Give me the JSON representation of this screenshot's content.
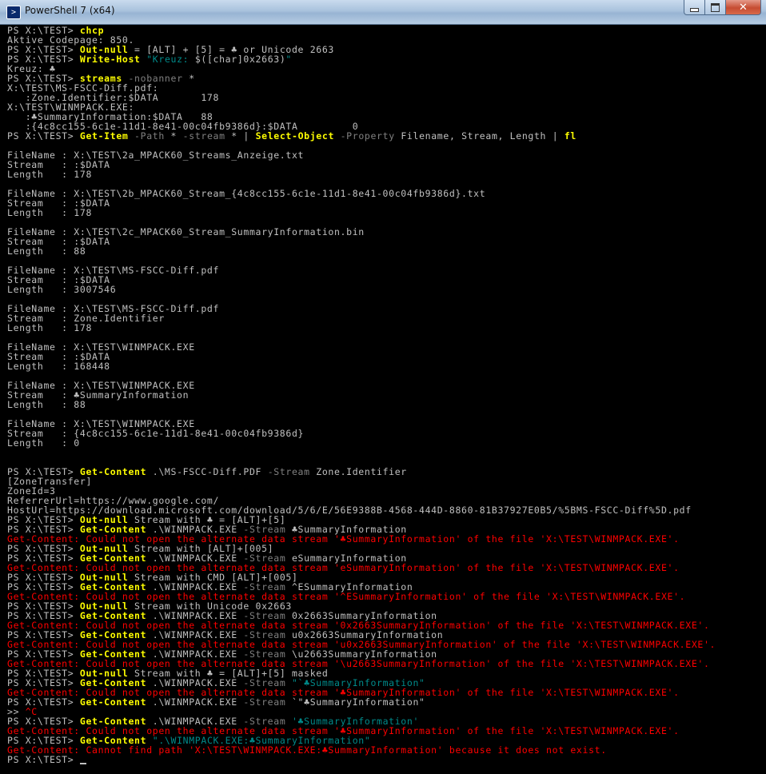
{
  "window": {
    "title": "PowerShell 7 (x64)",
    "close_glyph": "✕",
    "icon_glyph": ">"
  },
  "colors": {
    "background": "#000000",
    "default": "#c0c0c0",
    "command": "#ffff00",
    "parameter": "#808080",
    "string": "#008b8b",
    "error": "#ff0000"
  },
  "console": {
    "lines": [
      [
        [
          "PS X:\\TEST> ",
          "default"
        ],
        [
          "chcp",
          "command"
        ]
      ],
      [
        [
          "Aktive Codepage: 850.",
          "default"
        ]
      ],
      [
        [
          "PS X:\\TEST> ",
          "default"
        ],
        [
          "Out-null",
          "command"
        ],
        [
          " = [ALT] + [5] = ♣ or Unicode 2663",
          "default"
        ]
      ],
      [
        [
          "PS X:\\TEST> ",
          "default"
        ],
        [
          "Write-Host",
          "command"
        ],
        [
          " ",
          "default"
        ],
        [
          "\"Kreuz: ",
          "string"
        ],
        [
          "$([char]0x2663)",
          "default"
        ],
        [
          "\"",
          "string"
        ]
      ],
      [
        [
          "Kreuz: ♣",
          "default"
        ]
      ],
      [
        [
          "PS X:\\TEST> ",
          "default"
        ],
        [
          "streams",
          "command"
        ],
        [
          " -nobanner",
          "parameter"
        ],
        [
          " *",
          "default"
        ]
      ],
      [
        [
          "X:\\TEST\\MS-FSCC-Diff.pdf:",
          "default"
        ]
      ],
      [
        [
          "   :Zone.Identifier:$DATA       178",
          "default"
        ]
      ],
      [
        [
          "X:\\TEST\\WINMPACK.EXE:",
          "default"
        ]
      ],
      [
        [
          "   :♣SummaryInformation:$DATA   88",
          "default"
        ]
      ],
      [
        [
          "   :{4c8cc155-6c1e-11d1-8e41-00c04fb9386d}:$DATA         0",
          "default"
        ]
      ],
      [
        [
          "PS X:\\TEST> ",
          "default"
        ],
        [
          "Get-Item",
          "command"
        ],
        [
          " -Path",
          "parameter"
        ],
        [
          " * ",
          "default"
        ],
        [
          "-stream",
          "parameter"
        ],
        [
          " * | ",
          "default"
        ],
        [
          "Select-Object",
          "command"
        ],
        [
          " -Property",
          "parameter"
        ],
        [
          " Filename, Stream, Length | ",
          "default"
        ],
        [
          "fl",
          "command"
        ]
      ],
      [],
      [
        [
          "FileName : X:\\TEST\\2a_MPACK60_Streams_Anzeige.txt",
          "default"
        ]
      ],
      [
        [
          "Stream   : :$DATA",
          "default"
        ]
      ],
      [
        [
          "Length   : 178",
          "default"
        ]
      ],
      [],
      [
        [
          "FileName : X:\\TEST\\2b_MPACK60_Stream_{4c8cc155-6c1e-11d1-8e41-00c04fb9386d}.txt",
          "default"
        ]
      ],
      [
        [
          "Stream   : :$DATA",
          "default"
        ]
      ],
      [
        [
          "Length   : 178",
          "default"
        ]
      ],
      [],
      [
        [
          "FileName : X:\\TEST\\2c_MPACK60_Stream_SummaryInformation.bin",
          "default"
        ]
      ],
      [
        [
          "Stream   : :$DATA",
          "default"
        ]
      ],
      [
        [
          "Length   : 88",
          "default"
        ]
      ],
      [],
      [
        [
          "FileName : X:\\TEST\\MS-FSCC-Diff.pdf",
          "default"
        ]
      ],
      [
        [
          "Stream   : :$DATA",
          "default"
        ]
      ],
      [
        [
          "Length   : 3007546",
          "default"
        ]
      ],
      [],
      [
        [
          "FileName : X:\\TEST\\MS-FSCC-Diff.pdf",
          "default"
        ]
      ],
      [
        [
          "Stream   : Zone.Identifier",
          "default"
        ]
      ],
      [
        [
          "Length   : 178",
          "default"
        ]
      ],
      [],
      [
        [
          "FileName : X:\\TEST\\WINMPACK.EXE",
          "default"
        ]
      ],
      [
        [
          "Stream   : :$DATA",
          "default"
        ]
      ],
      [
        [
          "Length   : 168448",
          "default"
        ]
      ],
      [],
      [
        [
          "FileName : X:\\TEST\\WINMPACK.EXE",
          "default"
        ]
      ],
      [
        [
          "Stream   : ♣SummaryInformation",
          "default"
        ]
      ],
      [
        [
          "Length   : 88",
          "default"
        ]
      ],
      [],
      [
        [
          "FileName : X:\\TEST\\WINMPACK.EXE",
          "default"
        ]
      ],
      [
        [
          "Stream   : {4c8cc155-6c1e-11d1-8e41-00c04fb9386d}",
          "default"
        ]
      ],
      [
        [
          "Length   : 0",
          "default"
        ]
      ],
      [],
      [],
      [
        [
          "PS X:\\TEST> ",
          "default"
        ],
        [
          "Get-Content",
          "command"
        ],
        [
          " .\\MS-FSCC-Diff.PDF ",
          "default"
        ],
        [
          "-Stream",
          "parameter"
        ],
        [
          " Zone.Identifier",
          "default"
        ]
      ],
      [
        [
          "[ZoneTransfer]",
          "default"
        ]
      ],
      [
        [
          "ZoneId=3",
          "default"
        ]
      ],
      [
        [
          "ReferrerUrl=https://www.google.com/",
          "default"
        ]
      ],
      [
        [
          "HostUrl=https://download.microsoft.com/download/5/6/E/56E9388B-4568-444D-8860-81B37927E0B5/%5BMS-FSCC-Diff%5D.pdf",
          "default"
        ]
      ],
      [
        [
          "PS X:\\TEST> ",
          "default"
        ],
        [
          "Out-null",
          "command"
        ],
        [
          " Stream with ♣ = [ALT]+[5]",
          "default"
        ]
      ],
      [
        [
          "PS X:\\TEST> ",
          "default"
        ],
        [
          "Get-Content",
          "command"
        ],
        [
          " .\\WINMPACK.EXE ",
          "default"
        ],
        [
          "-Stream",
          "parameter"
        ],
        [
          " ♣SummaryInformation",
          "default"
        ]
      ],
      [
        [
          "Get-Content: Could not open the alternate data stream '♣SummaryInformation' of the file 'X:\\TEST\\WINMPACK.EXE'.",
          "error"
        ]
      ],
      [
        [
          "PS X:\\TEST> ",
          "default"
        ],
        [
          "Out-null",
          "command"
        ],
        [
          " Stream with [ALT]+[005]",
          "default"
        ]
      ],
      [
        [
          "PS X:\\TEST> ",
          "default"
        ],
        [
          "Get-Content",
          "command"
        ],
        [
          " .\\WINMPACK.EXE ",
          "default"
        ],
        [
          "-Stream",
          "parameter"
        ],
        [
          " eSummaryInformation",
          "default"
        ]
      ],
      [
        [
          "Get-Content: Could not open the alternate data stream 'eSummaryInformation' of the file 'X:\\TEST\\WINMPACK.EXE'.",
          "error"
        ]
      ],
      [
        [
          "PS X:\\TEST> ",
          "default"
        ],
        [
          "Out-null",
          "command"
        ],
        [
          " Stream with CMD [ALT]+[005]",
          "default"
        ]
      ],
      [
        [
          "PS X:\\TEST> ",
          "default"
        ],
        [
          "Get-Content",
          "command"
        ],
        [
          " .\\WINMPACK.EXE ",
          "default"
        ],
        [
          "-Stream",
          "parameter"
        ],
        [
          " ^ESummaryInformation",
          "default"
        ]
      ],
      [
        [
          "Get-Content: Could not open the alternate data stream '^ESummaryInformation' of the file 'X:\\TEST\\WINMPACK.EXE'.",
          "error"
        ]
      ],
      [
        [
          "PS X:\\TEST> ",
          "default"
        ],
        [
          "Out-null",
          "command"
        ],
        [
          " Stream with Unicode 0x2663",
          "default"
        ]
      ],
      [
        [
          "PS X:\\TEST> ",
          "default"
        ],
        [
          "Get-Content",
          "command"
        ],
        [
          " .\\WINMPACK.EXE ",
          "default"
        ],
        [
          "-Stream",
          "parameter"
        ],
        [
          " 0x2663SummaryInformation",
          "default"
        ]
      ],
      [
        [
          "Get-Content: Could not open the alternate data stream '0x2663SummaryInformation' of the file 'X:\\TEST\\WINMPACK.EXE'.",
          "error"
        ]
      ],
      [
        [
          "PS X:\\TEST> ",
          "default"
        ],
        [
          "Get-Content",
          "command"
        ],
        [
          " .\\WINMPACK.EXE ",
          "default"
        ],
        [
          "-Stream",
          "parameter"
        ],
        [
          " u0x2663SummaryInformation",
          "default"
        ]
      ],
      [
        [
          "Get-Content: Could not open the alternate data stream 'u0x2663SummaryInformation' of the file 'X:\\TEST\\WINMPACK.EXE'.",
          "error"
        ]
      ],
      [
        [
          "PS X:\\TEST> ",
          "default"
        ],
        [
          "Get-Content",
          "command"
        ],
        [
          " .\\WINMPACK.EXE ",
          "default"
        ],
        [
          "-Stream",
          "parameter"
        ],
        [
          " \\u2663SummaryInformation",
          "default"
        ]
      ],
      [
        [
          "Get-Content: Could not open the alternate data stream '\\u2663SummaryInformation' of the file 'X:\\TEST\\WINMPACK.EXE'.",
          "error"
        ]
      ],
      [
        [
          "PS X:\\TEST> ",
          "default"
        ],
        [
          "Out-null",
          "command"
        ],
        [
          " Stream with ♣ = [ALT]+[5] masked",
          "default"
        ]
      ],
      [
        [
          "PS X:\\TEST> ",
          "default"
        ],
        [
          "Get-Content",
          "command"
        ],
        [
          " .\\WINMPACK.EXE ",
          "default"
        ],
        [
          "-Stream",
          "parameter"
        ],
        [
          " ",
          "default"
        ],
        [
          "\"`♣SummaryInformation\"",
          "string"
        ]
      ],
      [
        [
          "Get-Content: Could not open the alternate data stream '♣SummaryInformation' of the file 'X:\\TEST\\WINMPACK.EXE'.",
          "error"
        ]
      ],
      [
        [
          "PS X:\\TEST> ",
          "default"
        ],
        [
          "Get-Content",
          "command"
        ],
        [
          " .\\WINMPACK.EXE ",
          "default"
        ],
        [
          "-Stream",
          "parameter"
        ],
        [
          " `\"♣SummaryInformation\"",
          "default"
        ]
      ],
      [
        [
          ">> ",
          "default"
        ],
        [
          "^C",
          "error"
        ]
      ],
      [
        [
          "PS X:\\TEST> ",
          "default"
        ],
        [
          "Get-Content",
          "command"
        ],
        [
          " .\\WINMPACK.EXE ",
          "default"
        ],
        [
          "-Stream",
          "parameter"
        ],
        [
          " ",
          "default"
        ],
        [
          "'♣SummaryInformation'",
          "string"
        ]
      ],
      [
        [
          "Get-Content: Could not open the alternate data stream '♣SummaryInformation' of the file 'X:\\TEST\\WINMPACK.EXE'.",
          "error"
        ]
      ],
      [
        [
          "PS X:\\TEST> ",
          "default"
        ],
        [
          "Get-Content",
          "command"
        ],
        [
          " ",
          "default"
        ],
        [
          "\".\\WINMPACK.EXE:♣SummaryInformation\"",
          "string"
        ]
      ],
      [
        [
          "Get-Content: Cannot find path 'X:\\TEST\\WINMPACK.EXE:♣SummaryInformation' because it does not exist.",
          "error"
        ]
      ],
      [
        [
          "PS X:\\TEST> ",
          "default"
        ]
      ]
    ]
  }
}
